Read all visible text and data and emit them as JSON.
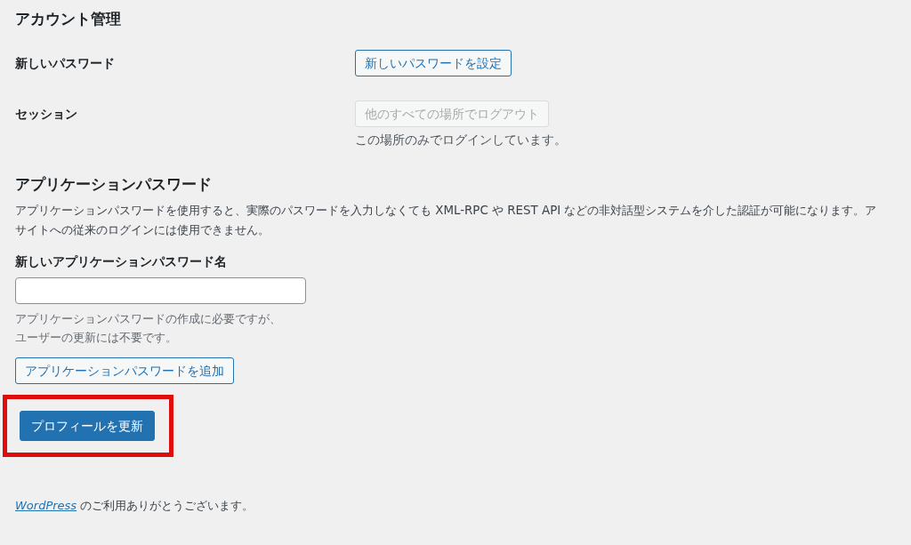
{
  "account_section": {
    "heading": "アカウント管理",
    "rows": [
      {
        "label": "新しいパスワード",
        "button": {
          "label": "新しいパスワードを設定",
          "disabled": false
        }
      },
      {
        "label": "セッション",
        "button": {
          "label": "他のすべての場所でログアウト",
          "disabled": true
        },
        "note": "この場所のみでログインしています。"
      }
    ]
  },
  "app_password_section": {
    "heading": "アプリケーションパスワード",
    "description_lines": [
      "アプリケーションパスワードを使用すると、実際のパスワードを入力しなくても XML-RPC や REST API などの非対話型システムを介した認証が可能になります。ア",
      "サイトへの従来のログインには使用できません。"
    ],
    "field_label": "新しいアプリケーションパスワード名",
    "field_hint_lines": [
      "アプリケーションパスワードの作成に必要ですが、",
      "ユーザーの更新には不要です。"
    ],
    "add_button": "アプリケーションパスワードを追加"
  },
  "submit_button": {
    "label": "プロフィールを更新",
    "highlighted": true
  },
  "footer": {
    "link": "WordPress",
    "text": "のご利用ありがとうございます。"
  }
}
